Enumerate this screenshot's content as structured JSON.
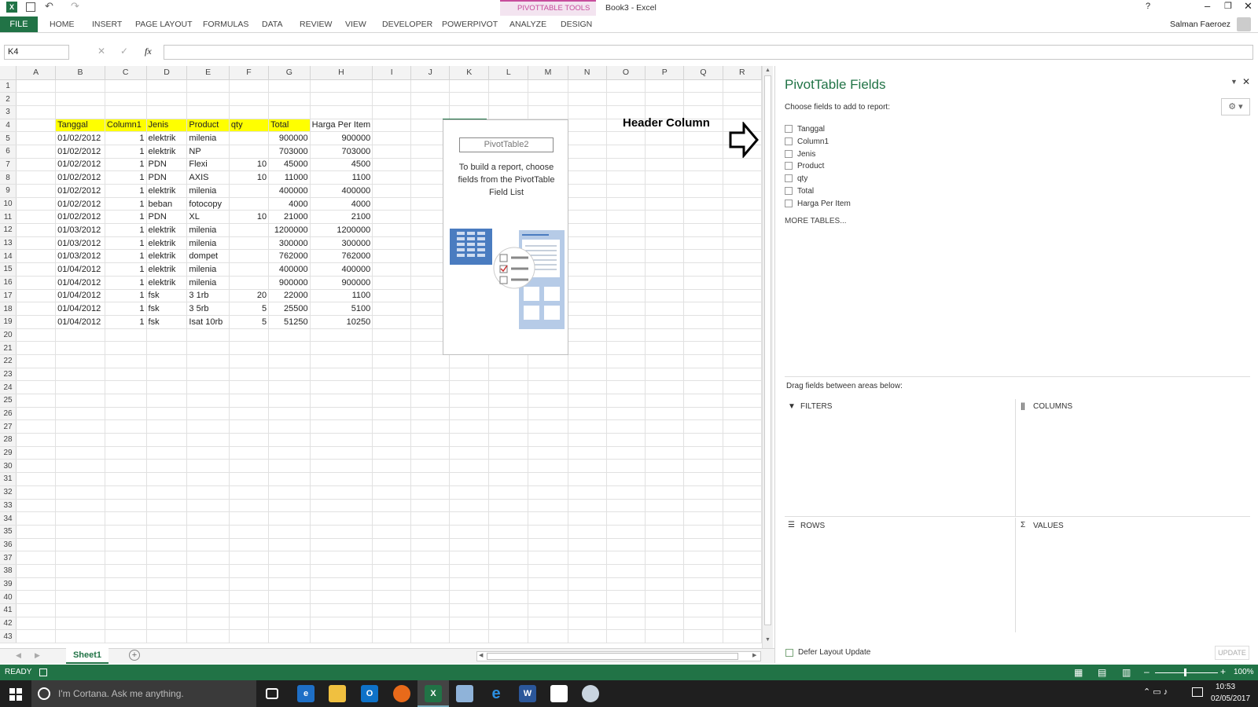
{
  "window": {
    "title": "Book3 - Excel",
    "context_group": "PIVOTTABLE TOOLS",
    "user": "Salman Faeroez"
  },
  "ribbon": {
    "tabs": [
      "FILE",
      "HOME",
      "INSERT",
      "PAGE LAYOUT",
      "FORMULAS",
      "DATA",
      "REVIEW",
      "VIEW",
      "DEVELOPER",
      "POWERPIVOT",
      "ANALYZE",
      "DESIGN"
    ]
  },
  "formula_bar": {
    "name_box": "K4",
    "fx": "fx",
    "value": ""
  },
  "grid": {
    "columns": [
      "A",
      "B",
      "C",
      "D",
      "E",
      "F",
      "G",
      "H",
      "I",
      "J",
      "K",
      "L",
      "M",
      "N",
      "O",
      "P",
      "Q",
      "R"
    ],
    "rows": [
      {
        "n": "1",
        "cells": [
          "",
          "",
          "",
          "",
          "",
          "",
          "",
          ""
        ]
      },
      {
        "n": "2",
        "cells": [
          "",
          "",
          "",
          "",
          "",
          "",
          "",
          ""
        ]
      },
      {
        "n": "3",
        "cells": [
          "",
          "",
          "",
          "",
          "",
          "",
          "",
          ""
        ]
      },
      {
        "n": "4",
        "cells": [
          "Tanggal",
          "Column1",
          "Jenis",
          "Product",
          "qty",
          "Total",
          "Harga Per Item",
          ""
        ]
      },
      {
        "n": "5",
        "cells": [
          "01/02/2012",
          "1",
          "elektrik",
          "milenia",
          "",
          "900000",
          "900000",
          ""
        ]
      },
      {
        "n": "6",
        "cells": [
          "01/02/2012",
          "1",
          "elektrik",
          "NP",
          "",
          "703000",
          "703000",
          ""
        ]
      },
      {
        "n": "7",
        "cells": [
          "01/02/2012",
          "1",
          "PDN",
          "Flexi",
          "10",
          "45000",
          "4500",
          ""
        ]
      },
      {
        "n": "8",
        "cells": [
          "01/02/2012",
          "1",
          "PDN",
          "AXIS",
          "10",
          "11000",
          "1100",
          ""
        ]
      },
      {
        "n": "9",
        "cells": [
          "01/02/2012",
          "1",
          "elektrik",
          "milenia",
          "",
          "400000",
          "400000",
          ""
        ]
      },
      {
        "n": "10",
        "cells": [
          "01/02/2012",
          "1",
          "beban",
          "fotocopy",
          "",
          "4000",
          "4000",
          ""
        ]
      },
      {
        "n": "11",
        "cells": [
          "01/02/2012",
          "1",
          "PDN",
          "XL",
          "10",
          "21000",
          "2100",
          ""
        ]
      },
      {
        "n": "12",
        "cells": [
          "01/03/2012",
          "1",
          "elektrik",
          "milenia",
          "",
          "1200000",
          "1200000",
          ""
        ]
      },
      {
        "n": "13",
        "cells": [
          "01/03/2012",
          "1",
          "elektrik",
          "milenia",
          "",
          "300000",
          "300000",
          ""
        ]
      },
      {
        "n": "14",
        "cells": [
          "01/03/2012",
          "1",
          "elektrik",
          "dompet",
          "",
          "762000",
          "762000",
          ""
        ]
      },
      {
        "n": "15",
        "cells": [
          "01/04/2012",
          "1",
          "elektrik",
          "milenia",
          "",
          "400000",
          "400000",
          ""
        ]
      },
      {
        "n": "16",
        "cells": [
          "01/04/2012",
          "1",
          "elektrik",
          "milenia",
          "",
          "900000",
          "900000",
          ""
        ]
      },
      {
        "n": "17",
        "cells": [
          "01/04/2012",
          "1",
          "fsk",
          "3 1rb",
          "20",
          "22000",
          "1100",
          ""
        ]
      },
      {
        "n": "18",
        "cells": [
          "01/04/2012",
          "1",
          "fsk",
          "3 5rb",
          "5",
          "25500",
          "5100",
          ""
        ]
      },
      {
        "n": "19",
        "cells": [
          "01/04/2012",
          "1",
          "fsk",
          "Isat 10rb",
          "5",
          "51250",
          "10250",
          ""
        ]
      }
    ],
    "empty_rows": [
      "20",
      "21",
      "22",
      "23",
      "24",
      "25",
      "26",
      "27",
      "28",
      "29",
      "30",
      "31",
      "32",
      "33",
      "34",
      "35",
      "36",
      "37",
      "38",
      "39",
      "40",
      "41",
      "42",
      "43"
    ]
  },
  "pivot_placeholder": {
    "name": "PivotTable2",
    "text": "To build a report, choose fields from the PivotTable Field List"
  },
  "annotation": {
    "text": "Header Column"
  },
  "pane": {
    "title": "PivotTable Fields",
    "subtitle": "Choose fields to add to report:",
    "fields": [
      "Tanggal",
      "Column1",
      "Jenis",
      "Product",
      "qty",
      "Total",
      "Harga Per Item"
    ],
    "more_tables": "MORE TABLES...",
    "drag_hint": "Drag fields between areas below:",
    "areas": {
      "filters": "FILTERS",
      "columns": "COLUMNS",
      "rows": "ROWS",
      "values": "VALUES"
    },
    "defer": "Defer Layout Update",
    "update": "UPDATE"
  },
  "sheet_tab": "Sheet1",
  "status": {
    "ready": "READY",
    "zoom": "100%"
  },
  "taskbar": {
    "search": "I'm Cortana. Ask me anything.",
    "time": "10:53",
    "date": "02/05/2017"
  },
  "colors": {
    "excel_green": "#217346",
    "header_yellow": "#ffff00",
    "pivot_pink": "#c74c9c"
  }
}
